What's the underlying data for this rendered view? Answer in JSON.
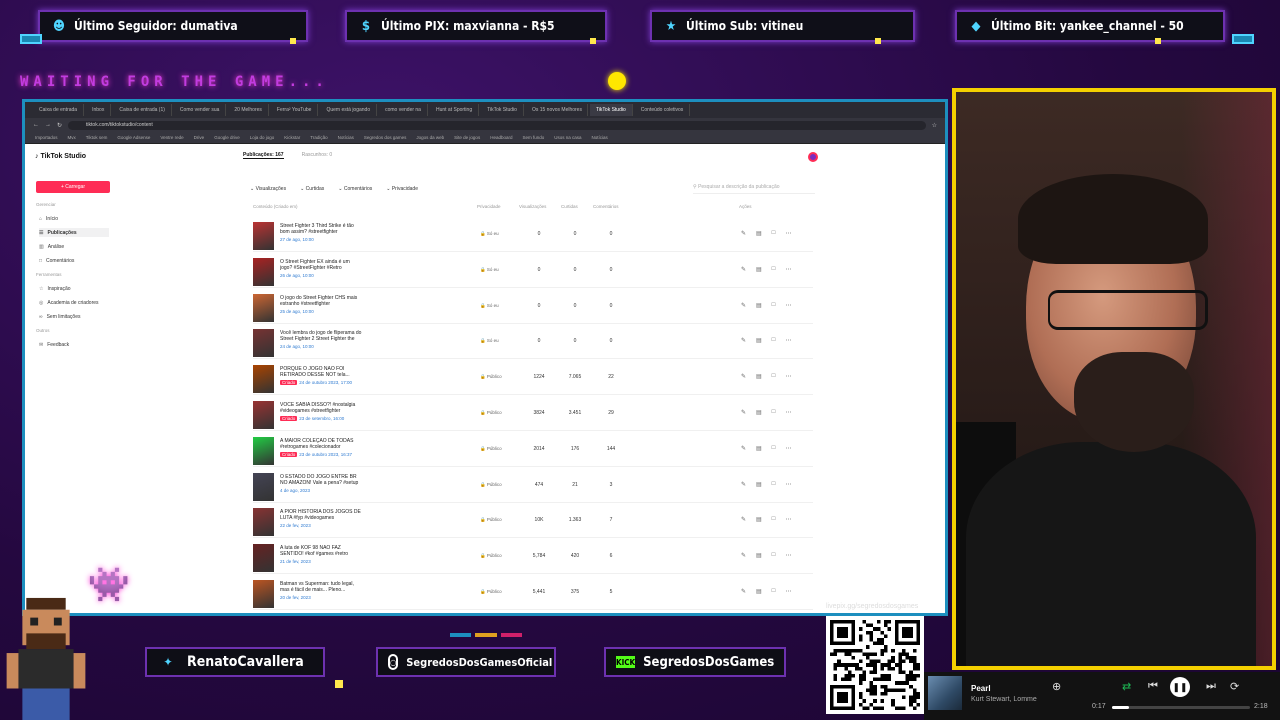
{
  "alerts": {
    "follower": "Último Seguidor: dumativa",
    "pix": "Último PIX: maxvianna - R$5",
    "sub": "Último Sub: vitineu",
    "bit": "Último Bit: yankee_channel - 50"
  },
  "waiting_text": "WAITING FOR THE GAME...",
  "browser": {
    "tabs": [
      "Caixa de entrada",
      "Inbox",
      "Caixa de entrada (1)",
      "Como vender sua",
      "20 Melhores",
      "Ferra² YouTube",
      "Quem está jogando",
      "como vender na",
      "Hunt at Sporting",
      "TikTok Studio",
      "Os 15 novos Melhores",
      "TikTok Studio",
      "Conteúdo coletivos"
    ],
    "active_tab": "TikTok Studio",
    "url": "tiktok.com/tiktokstudio/content",
    "bookmarks": [
      "Importados",
      "Mvx",
      "Tiktok sem",
      "Google Adsense",
      "Ventre rede",
      "Drive",
      "Google drive",
      "Loja do jogo",
      "Kickstar",
      "Tradição",
      "Notícias",
      "Segredos dos games",
      "Jogos da web",
      "Site de jogos",
      "Headboard",
      "Sem fundo",
      "Usos na casa",
      "Notícias"
    ]
  },
  "studio": {
    "logo": "TikTok Studio",
    "upload_label": "+ Carregar",
    "sidebar": {
      "section_manage": "Gerenciar",
      "items_manage": [
        {
          "icon": "home",
          "label": "Início"
        },
        {
          "icon": "posts",
          "label": "Publicações"
        },
        {
          "icon": "analytics",
          "label": "Análise"
        },
        {
          "icon": "comments",
          "label": "Comentários"
        }
      ],
      "section_tools": "Ferramentas",
      "items_tools": [
        {
          "icon": "inspiration",
          "label": "Inspiração"
        },
        {
          "icon": "academy",
          "label": "Academia de criadores"
        },
        {
          "icon": "unlimited",
          "label": "Sem limitações"
        }
      ],
      "section_other": "Outros",
      "items_other": [
        {
          "icon": "feedback",
          "label": "Feedback"
        }
      ]
    },
    "topnav": [
      "Publicações: 167",
      "Rascunhos: 0"
    ],
    "filters": [
      "Visualizações",
      "Curtidas",
      "Comentários",
      "Privacidade"
    ],
    "search_placeholder": "Pesquisar a descrição da publicação",
    "columns": [
      "Conteúdo (Criado em)",
      "Privacidade",
      "Visualizações",
      "Curtidas",
      "Comentários",
      "Ações"
    ],
    "rows": [
      {
        "title": "Street Fighter 3 Third Strike é tão bom assim? #streetfighter",
        "date": "27 de ago, 10:00",
        "tag": "",
        "privacy": "Só eu",
        "views": "0",
        "likes": "0",
        "comments": "0"
      },
      {
        "title": "O Street Fighter EX ainda é um jogo? #StreetFighter #Retro",
        "date": "26 de ago, 10:00",
        "tag": "",
        "privacy": "Só eu",
        "views": "0",
        "likes": "0",
        "comments": "0"
      },
      {
        "title": "O jogo do Street Fighter CHS mais estranho #streetfighter",
        "date": "25 de ago, 10:00",
        "tag": "",
        "privacy": "Só eu",
        "views": "0",
        "likes": "0",
        "comments": "0"
      },
      {
        "title": "Você lembra do jogo de fliperama do Street Fighter 2 Street Fighter the",
        "date": "24 de ago, 10:00",
        "tag": "",
        "privacy": "Só eu",
        "views": "0",
        "likes": "0",
        "comments": "0"
      },
      {
        "title": "PORQUE O JOGO NÃO FOI RETIRADO DESSE NOT tela...",
        "date": "24 de outubro 2023, 17:00",
        "tag": "Criado",
        "privacy": "Público",
        "views": "1224",
        "likes": "7.065",
        "comments": "22"
      },
      {
        "title": "VOCÊ SABIA DISSO?! #nostalgia #videogames #streetfighter",
        "date": "23 de setembro, 16:00",
        "tag": "Criado",
        "privacy": "Público",
        "views": "3824",
        "likes": "3.451",
        "comments": "29"
      },
      {
        "title": "A MAIOR COLEÇÃO DE TODAS #retrogames #colecionador",
        "date": "23 de outubro 2023, 16:37",
        "tag": "Criado",
        "privacy": "Público",
        "views": "2014",
        "likes": "176",
        "comments": "144"
      },
      {
        "title": "O ESTADO DO JOGO ENTRE BR NO AMAZON! Vale a pena? #setup",
        "date": "4 de ago, 2023",
        "tag": "",
        "privacy": "Público",
        "views": "474",
        "likes": "21",
        "comments": "3"
      },
      {
        "title": "A PIOR HISTÓRIA DOS JOGOS DE LUTA #fyp #videogames",
        "date": "22 de fev, 2023",
        "tag": "",
        "privacy": "Público",
        "views": "10K",
        "likes": "1.363",
        "comments": "7"
      },
      {
        "title": "A luta de KOF 98 NÃO FAZ SENTIDO! #kof #games #retro",
        "date": "21 de fev, 2023",
        "tag": "",
        "privacy": "Público",
        "views": "5,784",
        "likes": "420",
        "comments": "6"
      },
      {
        "title": "Batman vs Superman: tudo legal, mas é fácil de mais... Pleno...",
        "date": "20 de fev, 2023",
        "tag": "",
        "privacy": "Público",
        "views": "5,441",
        "likes": "375",
        "comments": "5"
      }
    ]
  },
  "socials": {
    "twitter": "RenatoCavallera",
    "instagram": "SegredosDosGamesOficial",
    "kick_badge": "KICK",
    "kick": "SegredosDosGames"
  },
  "qr_caption": "livepix.gg/segredosdosgames",
  "player": {
    "song": "Pearl",
    "artist": "Kurt Stewart, Lomme",
    "current_time": "0:17",
    "total_time": "2:18",
    "progress": 0.12
  },
  "colors": {
    "background": "#2a0b48",
    "frame_border": "#6d31b0",
    "screen_border": "#1d8fbf",
    "cam_border": "#f4d000",
    "tiktok_red": "#fe2c55",
    "kick_green": "#53fc18"
  }
}
